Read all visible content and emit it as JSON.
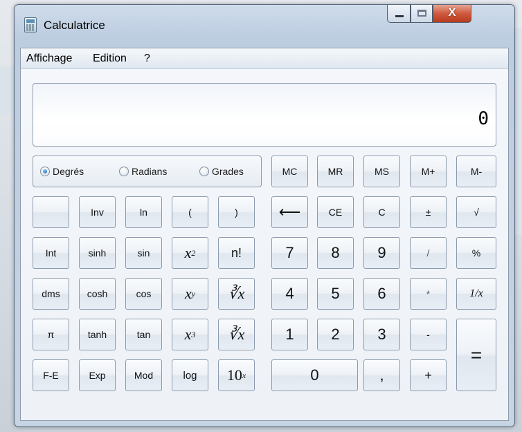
{
  "window": {
    "title": "Calculatrice",
    "close_glyph": "X"
  },
  "menu": [
    "Affichage",
    "Edition",
    "?"
  ],
  "display": {
    "value": "0"
  },
  "angle_modes": {
    "options": [
      "Degrés",
      "Radians",
      "Grades"
    ],
    "selected": "Degrés"
  },
  "keys": {
    "mc": "MC",
    "mr": "MR",
    "ms": "MS",
    "mplus": "M+",
    "mminus": "M-",
    "inv": "Inv",
    "ln": "ln",
    "lparen": "(",
    "rparen": ")",
    "backspace": "⟵",
    "ce": "CE",
    "c": "C",
    "plusminus": "±",
    "sqrt": "√",
    "int": "Int",
    "sinh": "sinh",
    "sin": "sin",
    "x2_base": "x",
    "x2_exp": "2",
    "fact": "n!",
    "d7": "7",
    "d8": "8",
    "d9": "9",
    "div": "/",
    "pct": "%",
    "dms": "dms",
    "cosh": "cosh",
    "cos": "cos",
    "xy_base": "x",
    "xy_exp": "y",
    "yroot": "∛x",
    "d4": "4",
    "d5": "5",
    "d6": "6",
    "mul": "*",
    "recip": "1/x",
    "pi": "π",
    "tanh": "tanh",
    "tan": "tan",
    "x3_base": "x",
    "x3_exp": "3",
    "croot": "∛x",
    "d1": "1",
    "d2": "2",
    "d3": "3",
    "sub": "-",
    "eq": "=",
    "fe": "F-E",
    "exp": "Exp",
    "mod": "Mod",
    "log": "log",
    "tenx_base": "10",
    "tenx_exp": "x",
    "d0": "0",
    "dec": ",",
    "add": "+"
  }
}
